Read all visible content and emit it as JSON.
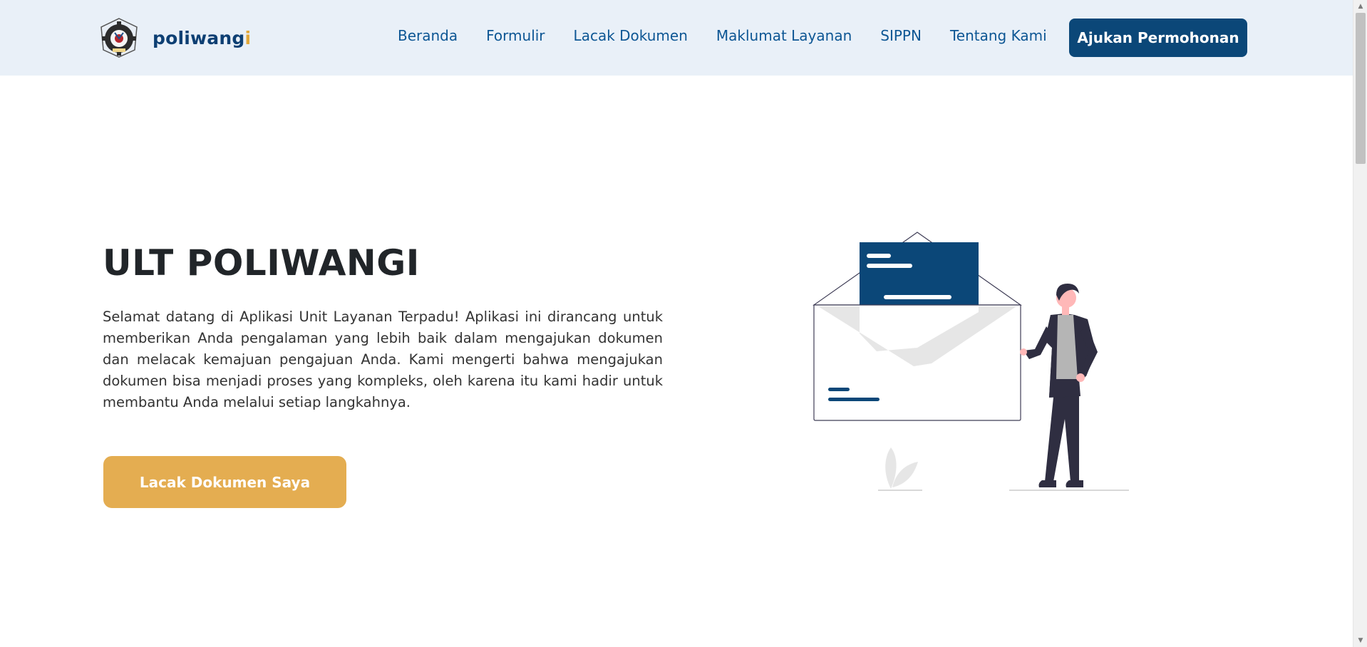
{
  "brand": {
    "name_main": "poliwang",
    "name_accent": "i",
    "logo_icon": "poliwangi-emblem-icon"
  },
  "nav": {
    "links": [
      "Beranda",
      "Formulir",
      "Lacak Dokumen",
      "Maklumat Layanan",
      "SIPPN",
      "Tentang Kami"
    ],
    "cta": "Ajukan Permohonan"
  },
  "hero": {
    "title": "ULT POLIWANGI",
    "description": "Selamat datang di Aplikasi Unit Layanan Terpadu! Aplikasi ini dirancang untuk memberikan Anda pengalaman yang lebih baik dalam mengajukan dokumen dan melacak kemajuan pengajuan Anda. Kami mengerti bahwa mengajukan dokumen bisa menjadi proses yang kompleks, oleh karena itu kami hadir untuk membantu Anda melalui setiap langkahnya.",
    "button": "Lacak Dokumen Saya",
    "illustration_icon": "envelope-document-person-illustration"
  },
  "colors": {
    "navbar_bg": "#e9f0f8",
    "primary": "#0b4778",
    "nav_text": "#0d5694",
    "accent": "#e4ad51",
    "title_text": "#212529"
  }
}
